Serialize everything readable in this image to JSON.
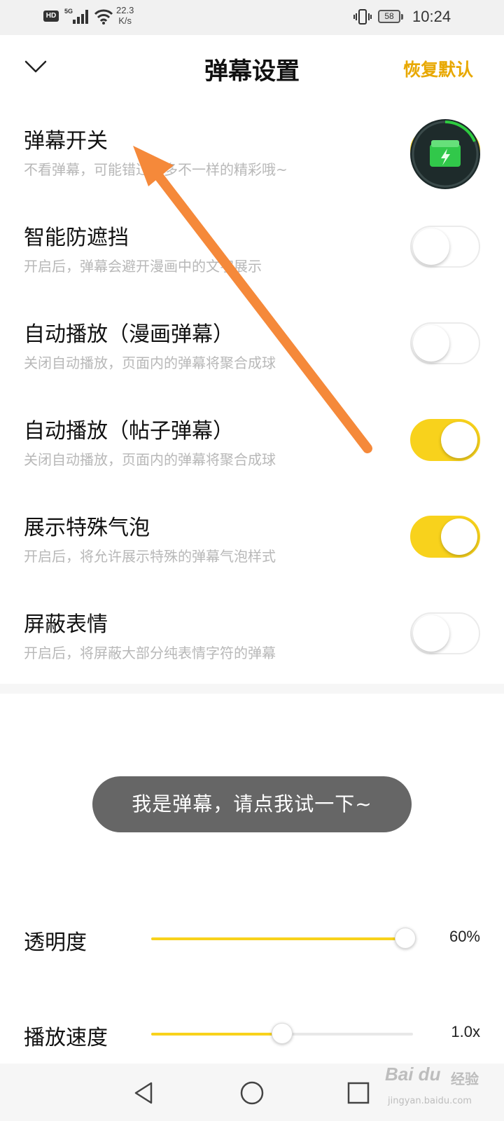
{
  "status_bar": {
    "network_badge": "HD",
    "signal_label": "5G",
    "speed_value": "22.3",
    "speed_unit": "K/s",
    "battery": "58",
    "time": "10:24"
  },
  "header": {
    "title": "弹幕设置",
    "reset_label": "恢复默认"
  },
  "settings": [
    {
      "title": "弹幕开关",
      "desc": "不看弹幕，可能错过很多不一样的精彩哦~",
      "on": true
    },
    {
      "title": "智能防遮挡",
      "desc": "开启后，弹幕会避开漫画中的文字展示",
      "on": false
    },
    {
      "title": "自动播放（漫画弹幕）",
      "desc": "关闭自动播放，页面内的弹幕将聚合成球",
      "on": false
    },
    {
      "title": "自动播放（帖子弹幕）",
      "desc": "关闭自动播放，页面内的弹幕将聚合成球",
      "on": true
    },
    {
      "title": "展示特殊气泡",
      "desc": "开启后，将允许展示特殊的弹幕气泡样式",
      "on": true
    },
    {
      "title": "屏蔽表情",
      "desc": "开启后，将屏蔽大部分纯表情字符的弹幕",
      "on": false
    }
  ],
  "preview": {
    "text": "我是弹幕，请点我试一下~"
  },
  "sliders": {
    "opacity": {
      "label": "透明度",
      "value_label": "60%",
      "fraction": 0.97
    },
    "speed": {
      "label": "播放速度",
      "value_label": "1.0x",
      "fraction": 0.5
    }
  },
  "watermark": {
    "brand": "Bai du",
    "sub": "经验",
    "url": "jingyan.baidu.com"
  },
  "colors": {
    "accent": "#f8d21c",
    "reset_text": "#e8a800",
    "annotation_arrow": "#f5893a",
    "bubble_bg": "#666666"
  }
}
